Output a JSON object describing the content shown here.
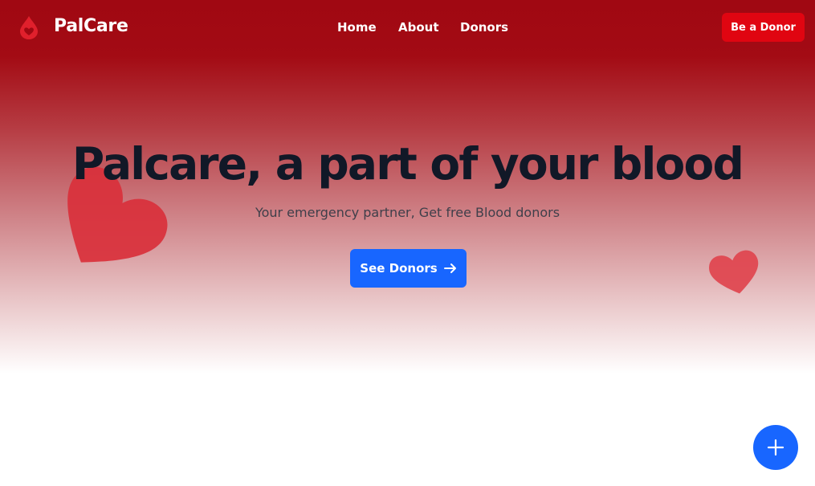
{
  "nav": {
    "brand": "PalCare",
    "logo_icon": "blood-drop-heart-icon",
    "links": [
      {
        "label": "Home"
      },
      {
        "label": "About"
      },
      {
        "label": "Donors"
      }
    ],
    "cta_label": "Be a Donor"
  },
  "hero": {
    "headline": "Palcare, a part of your blood",
    "subline": "Your emergency partner, Get free Blood donors",
    "button_label": "See Donors",
    "button_icon": "arrow-right-icon",
    "decor_icon": "heart-icon"
  },
  "fab": {
    "icon": "plus-icon"
  },
  "colors": {
    "brand_red": "#a00812",
    "cta_red": "#e00511",
    "primary_blue": "#1866ff",
    "heading": "#111827",
    "heart": "#d9303b"
  }
}
